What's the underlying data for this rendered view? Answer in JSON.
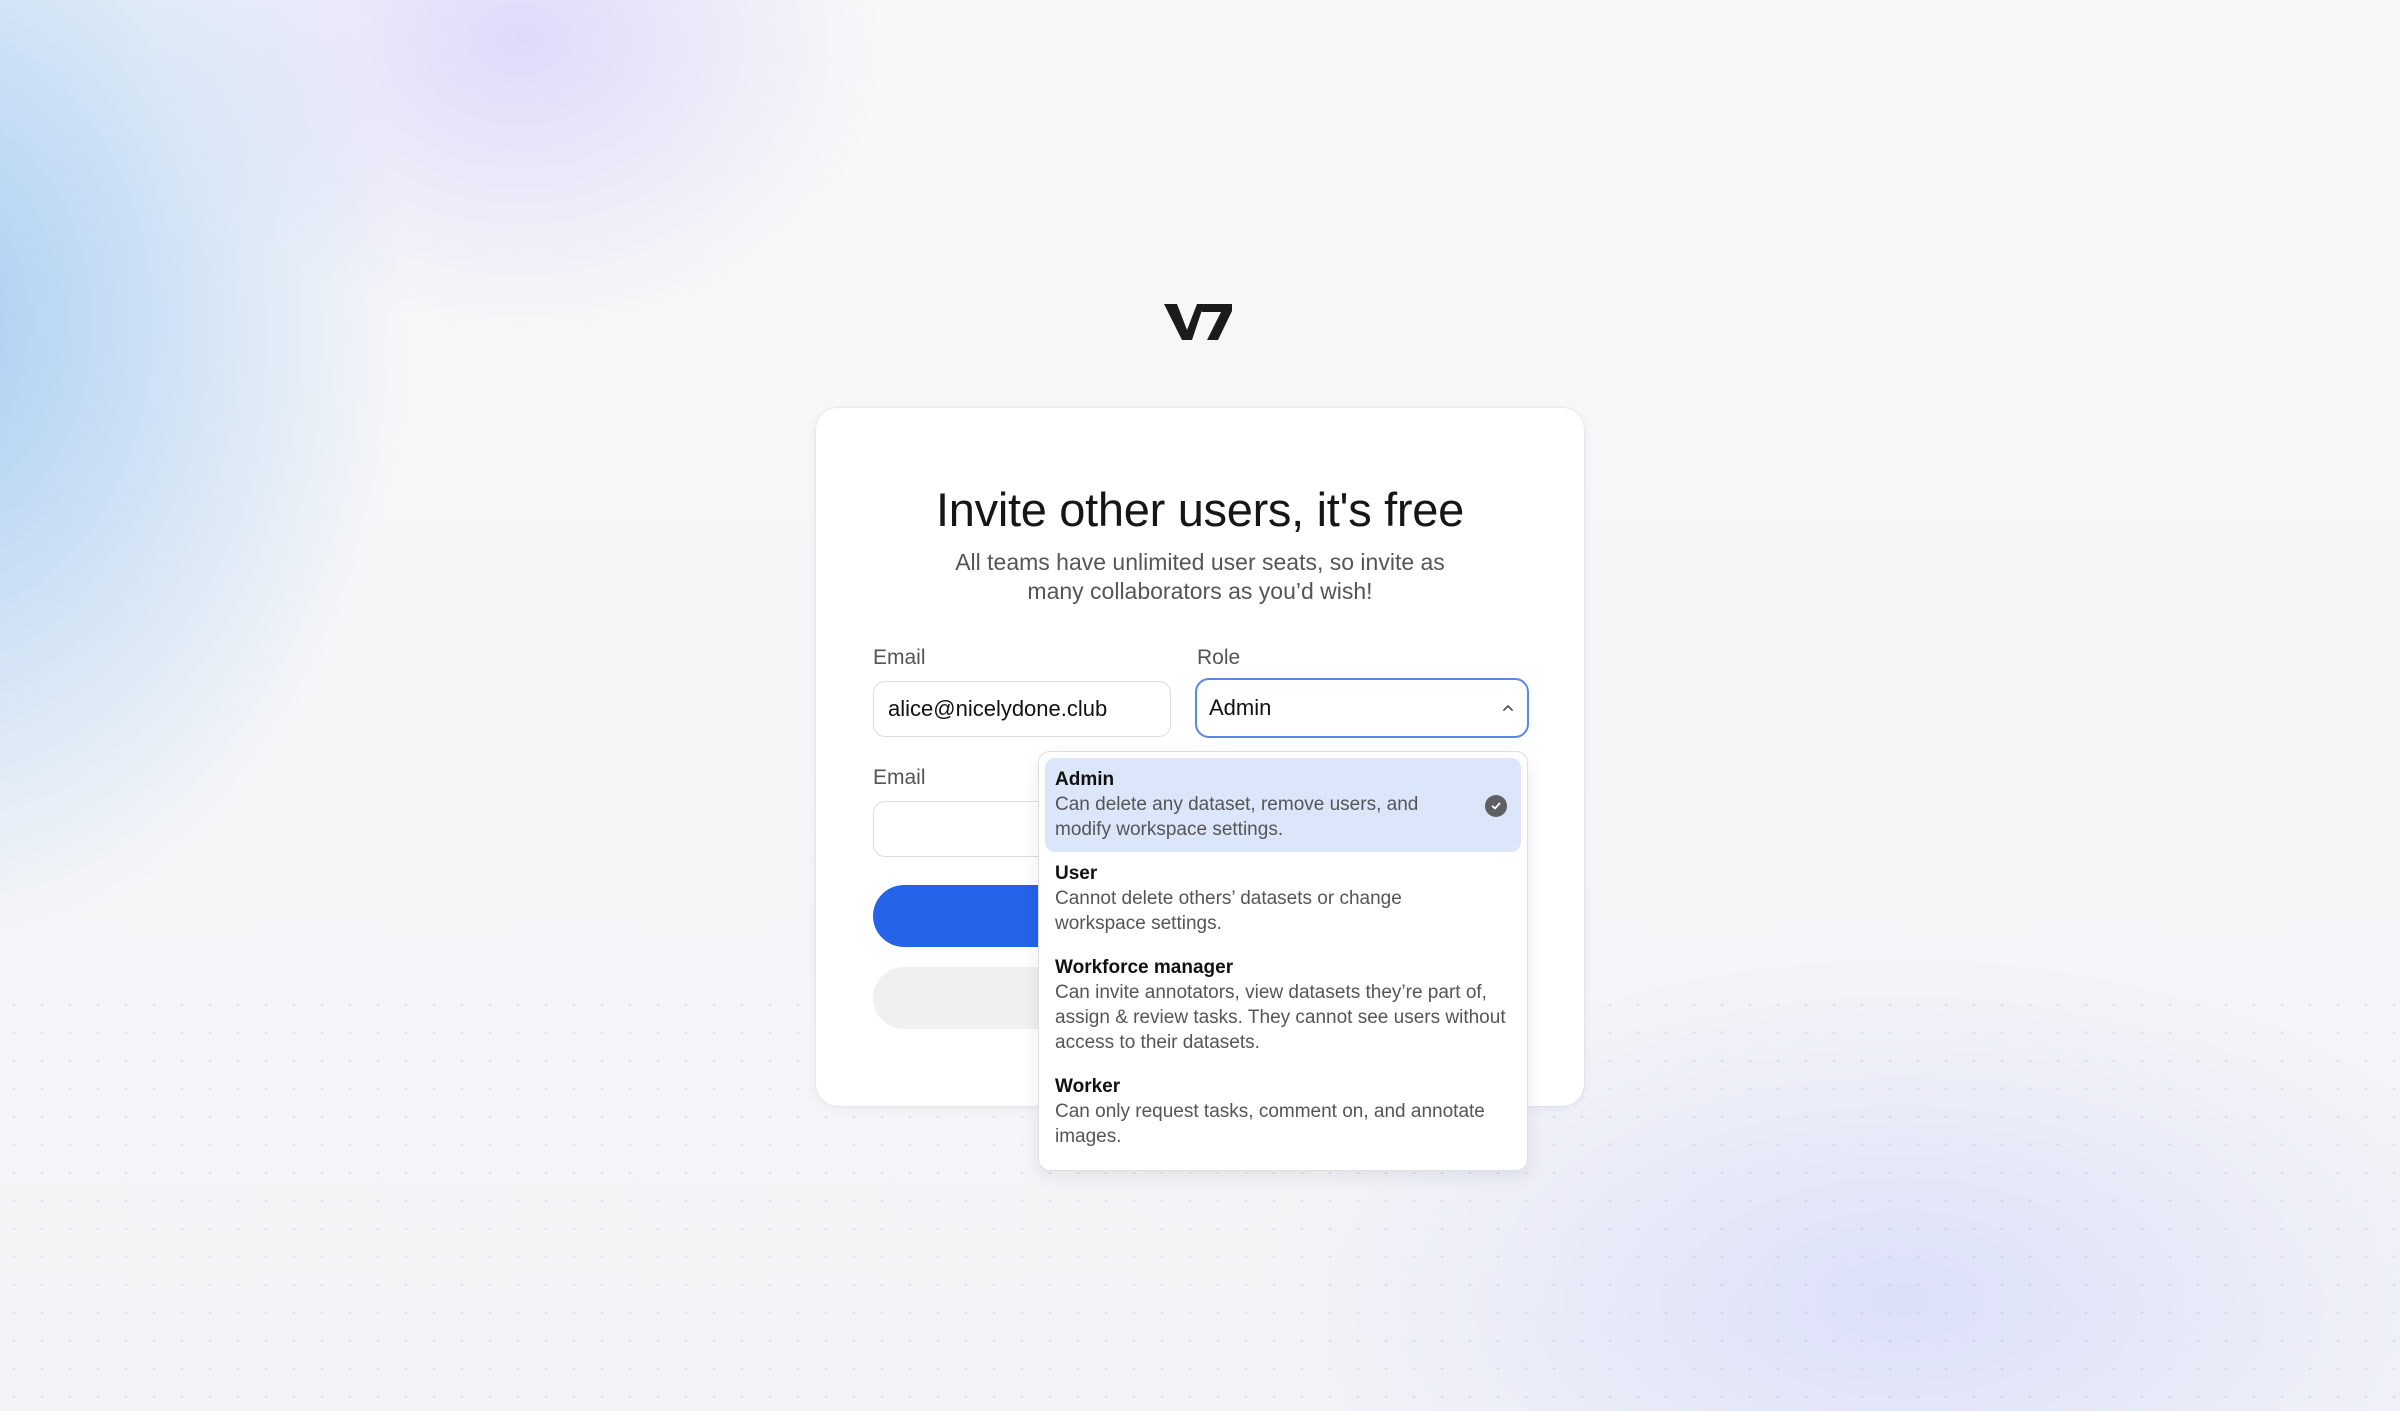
{
  "brand": {
    "logo_text": "V7"
  },
  "card": {
    "title": "Invite other users, it's free",
    "subtitle": "All teams have unlimited user seats, so invite as many collaborators as you’d wish!"
  },
  "form": {
    "row1": {
      "email_label": "Email",
      "email_value": "alice@nicelydone.club",
      "role_label": "Role",
      "role_value": "Admin"
    },
    "row2": {
      "email_label": "Email",
      "email_value": ""
    }
  },
  "role_dropdown": {
    "options": [
      {
        "title": "Admin",
        "description": "Can delete any dataset, remove users, and modify workspace settings.",
        "selected": true
      },
      {
        "title": "User",
        "description": "Cannot delete others’ datasets or change workspace settings.",
        "selected": false
      },
      {
        "title": "Workforce manager",
        "description": "Can invite annotators, view datasets they’re part of, assign & review tasks. They cannot see users without access to their datasets.",
        "selected": false
      },
      {
        "title": "Worker",
        "description": "Can only request tasks, comment on, and annotate images.",
        "selected": false
      }
    ]
  },
  "colors": {
    "accent": "#2563e8",
    "focus_ring": "#5b87e6",
    "selected_option_bg": "#dbe6fb"
  },
  "icons": {
    "logo": "v7-logo",
    "select_chevron": "chevron-up-icon",
    "selected_check": "check-circle-icon"
  }
}
